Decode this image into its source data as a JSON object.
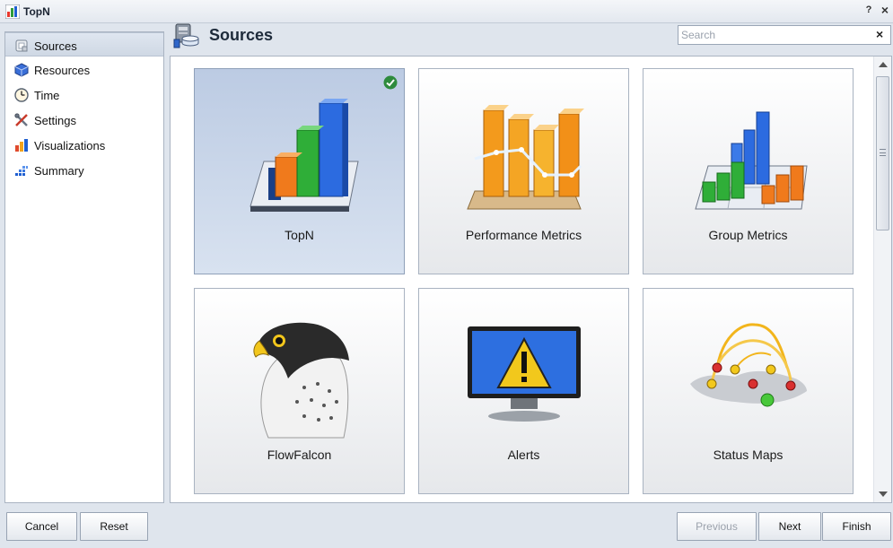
{
  "window": {
    "title": "TopN",
    "help_label": "?",
    "close_label": "×"
  },
  "sidebar": {
    "items": [
      {
        "label": "Sources",
        "icon": "sources-icon",
        "selected": true
      },
      {
        "label": "Resources",
        "icon": "resources-icon",
        "selected": false
      },
      {
        "label": "Time",
        "icon": "clock-icon",
        "selected": false
      },
      {
        "label": "Settings",
        "icon": "settings-tools-icon",
        "selected": false
      },
      {
        "label": "Visualizations",
        "icon": "visualizations-chart-icon",
        "selected": false
      },
      {
        "label": "Summary",
        "icon": "summary-icon",
        "selected": false
      }
    ]
  },
  "header": {
    "title": "Sources",
    "icon": "sources-database-icon"
  },
  "search": {
    "placeholder": "Search",
    "value": "",
    "clear_label": "×"
  },
  "tiles": [
    {
      "label": "TopN",
      "icon": "topn-bar-chart-icon",
      "selected": true
    },
    {
      "label": "Performance Metrics",
      "icon": "performance-metrics-chart-icon",
      "selected": false
    },
    {
      "label": "Group Metrics",
      "icon": "group-metrics-chart-icon",
      "selected": false
    },
    {
      "label": "FlowFalcon",
      "icon": "falcon-icon",
      "selected": false
    },
    {
      "label": "Alerts",
      "icon": "alert-monitor-icon",
      "selected": false
    },
    {
      "label": "Status Maps",
      "icon": "status-map-icon",
      "selected": false
    }
  ],
  "footer": {
    "cancel_label": "Cancel",
    "reset_label": "Reset",
    "previous_label": "Previous",
    "next_label": "Next",
    "finish_label": "Finish"
  },
  "colors": {
    "accent": "#1c6bd6",
    "selected_tile": "#c7d4ea",
    "check": "#2e8b3d",
    "alert_yellow": "#f2c81c"
  }
}
